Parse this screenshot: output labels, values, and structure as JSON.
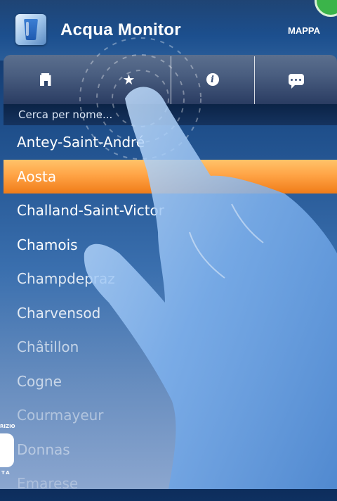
{
  "header": {
    "title": "Acqua Monitor",
    "map_link": "MAPPA",
    "app_icon": "water-glass-icon"
  },
  "tabs": [
    {
      "icon": "building-icon"
    },
    {
      "icon": "star-icon",
      "glyph": "★"
    },
    {
      "icon": "info-icon",
      "glyph": "i"
    },
    {
      "icon": "chat-icon"
    }
  ],
  "search": {
    "placeholder": "Cerca per nome..."
  },
  "list": {
    "items": [
      "Antey-Saint-André",
      "Aosta",
      "Challand-Saint-Victor",
      "Chamois",
      "Champdepraz",
      "Charvensod",
      "Châtillon",
      "Cogne",
      "Courmayeur",
      "Donnas",
      "Emarese"
    ],
    "selected": "Aosta"
  },
  "logo": {
    "top_text": "RIZIO",
    "bottom_text": "TA"
  },
  "colors": {
    "header_bg": "#1c4f8e",
    "selected_row": "#ffa446",
    "text": "#ffffff",
    "corner_badge": "#3bb44a"
  }
}
